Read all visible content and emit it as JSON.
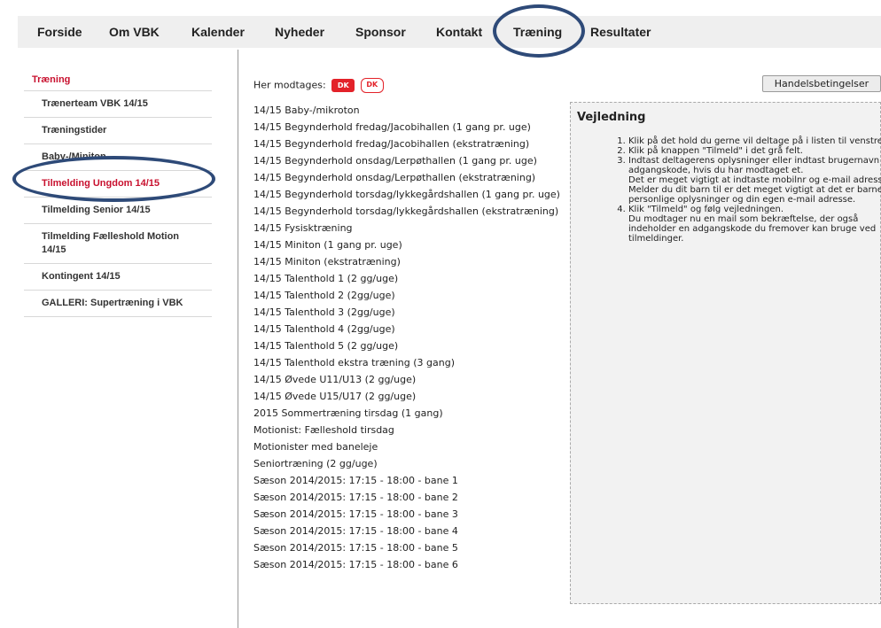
{
  "nav": {
    "items": [
      "Forside",
      "Om VBK",
      "Kalender",
      "Nyheder",
      "Sponsor",
      "Kontakt",
      "Træning",
      "Resultater"
    ]
  },
  "sidebar": {
    "heading": "Træning",
    "items": [
      "Trænerteam VBK 14/15",
      "Træningstider",
      "Baby-/Miniton",
      "Tilmelding Ungdom 14/15",
      "Tilmelding Senior 14/15",
      "Tilmelding Fælleshold Motion 14/15",
      "Kontingent 14/15",
      "GALLERI: Supertræning i VBK"
    ],
    "active_index": 3
  },
  "main": {
    "receive_label": "Her modtages:",
    "logos": [
      "DK",
      "DK"
    ],
    "teams": [
      "14/15 Baby-/mikroton",
      "14/15 Begynderhold fredag/Jacobihallen (1 gang pr. uge)",
      "14/15 Begynderhold fredag/Jacobihallen (ekstratræning)",
      "14/15 Begynderhold onsdag/Lerpøthallen (1 gang pr. uge)",
      "14/15 Begynderhold onsdag/Lerpøthallen (ekstratræning)",
      "14/15 Begynderhold torsdag/lykkegårdshallen (1 gang pr. uge)",
      "14/15 Begynderhold torsdag/lykkegårdshallen (ekstratræning)",
      "14/15 Fysisktræning",
      "14/15 Miniton (1 gang pr. uge)",
      "14/15 Miniton (ekstratræning)",
      "14/15 Talenthold 1 (2 gg/uge)",
      "14/15 Talenthold 2 (2gg/uge)",
      "14/15 Talenthold 3 (2gg/uge)",
      "14/15 Talenthold 4 (2gg/uge)",
      "14/15 Talenthold 5 (2 gg/uge)",
      "14/15 Talenthold ekstra træning (3 gang)",
      "14/15 Øvede U11/U13 (2 gg/uge)",
      "14/15 Øvede U15/U17 (2 gg/uge)",
      "2015 Sommertræning tirsdag (1 gang)",
      "Motionist: Fælleshold tirsdag",
      "Motionister med baneleje",
      "Seniortræning (2 gg/uge)",
      "Sæson 2014/2015: 17:15 - 18:00 - bane 1",
      "Sæson 2014/2015: 17:15 - 18:00 - bane 2",
      "Sæson 2014/2015: 17:15 - 18:00 - bane 3",
      "Sæson 2014/2015: 17:15 - 18:00 - bane 4",
      "Sæson 2014/2015: 17:15 - 18:00 - bane 5",
      "Sæson 2014/2015: 17:15 - 18:00 - bane 6"
    ]
  },
  "guide": {
    "terms_button": "Handelsbetingelser",
    "title": "Vejledning",
    "steps": [
      "Klik på det hold du gerne vil deltage på i listen til venstre.",
      "Klik på knappen \"Tilmeld\" i det grå felt.",
      "Indtast deltagerens oplysninger eller indtast brugernavn og adgangskode, hvis du har modtaget et.\nDet er meget vigtigt at indtaste mobilnr og e-mail adresse.\nMelder du dit barn til er det meget vigtigt at det er barnets personlige oplysninger og din egen e-mail adresse.",
      "Klik \"Tilmeld\" og følg vejledningen.\nDu modtager nu en mail som bekræftelse, der også indeholder en adgangskode du fremover kan bruge ved tilmeldinger."
    ]
  },
  "colors": {
    "accent_red": "#c8102e",
    "annotation_blue": "#2e4a78",
    "nav_bg": "#efefef",
    "guide_bg": "#f2f2f2"
  }
}
